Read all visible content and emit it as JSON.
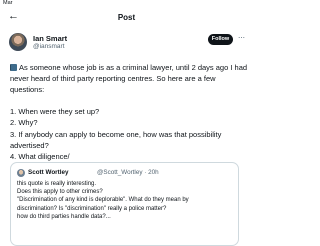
{
  "status_bar": {
    "app": "Mar"
  },
  "header": {
    "back_icon": "arrow-left-icon",
    "title": "Post"
  },
  "author": {
    "name": "Ian Smart",
    "handle": "@iansmart",
    "follow_label": "Follow",
    "more_icon": "more-dots-icon"
  },
  "post": {
    "emoji_icon": "book-emoji-icon",
    "lines": [
      "As someone whose job is as a criminal lawyer, until 2 days ago I had",
      "never heard of third party reporting centres. So here are a few",
      "questions:",
      "",
      "1. When were they set up?",
      "2. Why?",
      "3. If anybody can apply to become one, how was that possibility",
      "advertised?",
      "4. What diligence/"
    ]
  },
  "quoted": {
    "name": "Scott Wortley",
    "meta": "@Scott_Wortley · 20h",
    "lines": [
      "this quote is really interesting.",
      "Does this apply to other crimes?",
      "\"Discrimination of any kind is deplorable\". What do they mean by",
      "discrimination? Is \"discrimination\" really a police matter?",
      "how do third parties handle data?..."
    ]
  }
}
